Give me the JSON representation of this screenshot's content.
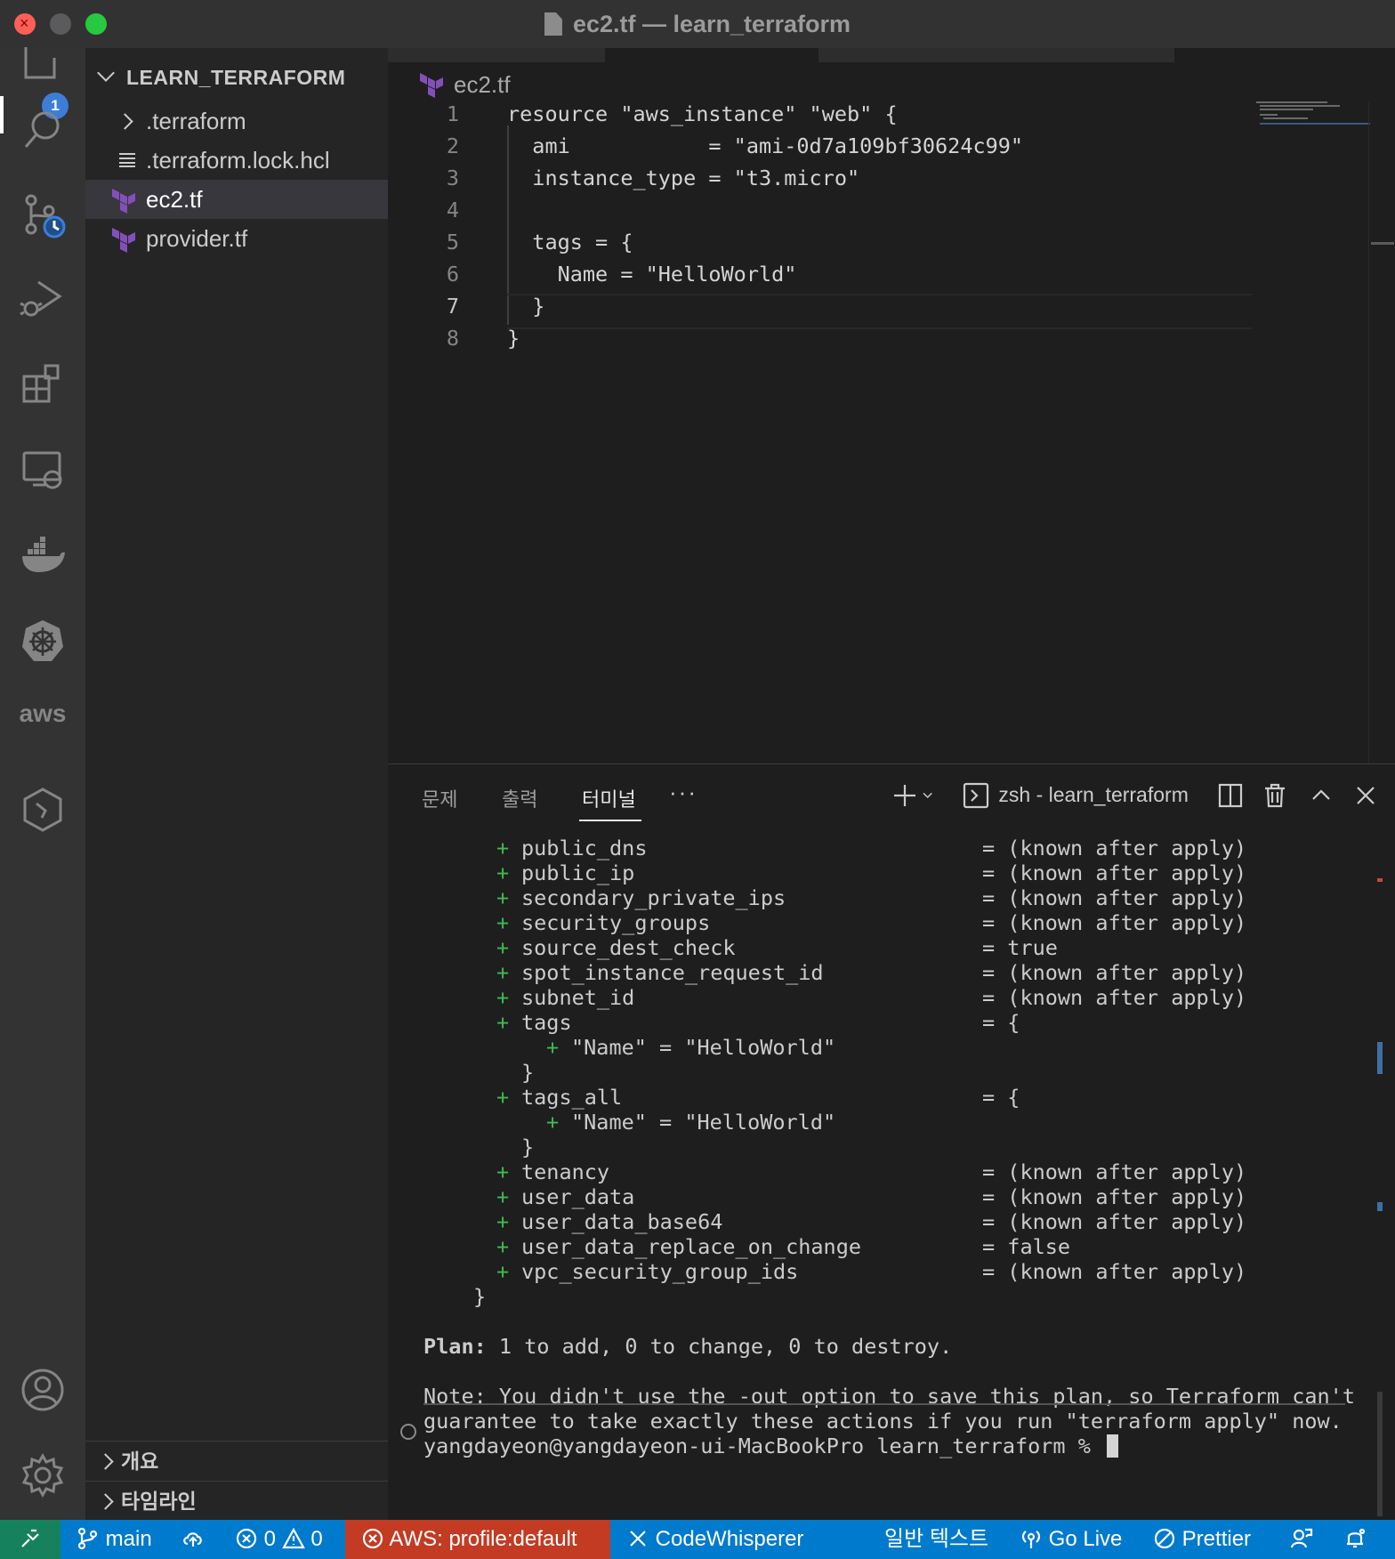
{
  "window": {
    "title": "ec2.tf — learn_terraform"
  },
  "activity_bar": {
    "source_control_badge": "1",
    "aws_label": "aws"
  },
  "explorer": {
    "root": "LEARN_TERRAFORM",
    "items": [
      {
        "label": ".terraform",
        "kind": "folder"
      },
      {
        "label": ".terraform.lock.hcl",
        "kind": "file"
      },
      {
        "label": "ec2.tf",
        "kind": "terraform",
        "active": true
      },
      {
        "label": "provider.tf",
        "kind": "terraform"
      }
    ],
    "outline_label": "개요",
    "timeline_label": "타임라인"
  },
  "editor": {
    "breadcrumb": "ec2.tf",
    "current_line": 7,
    "lines": [
      {
        "num": "1",
        "text": "resource \"aws_instance\" \"web\" {"
      },
      {
        "num": "2",
        "text": "  ami           = \"ami-0d7a109bf30624c99\""
      },
      {
        "num": "3",
        "text": "  instance_type = \"t3.micro\""
      },
      {
        "num": "4",
        "text": ""
      },
      {
        "num": "5",
        "text": "  tags = {"
      },
      {
        "num": "6",
        "text": "    Name = \"HelloWorld\""
      },
      {
        "num": "7",
        "text": "  }"
      },
      {
        "num": "8",
        "text": "}"
      }
    ]
  },
  "panel": {
    "tabs": [
      "문제",
      "출력",
      "터미널"
    ],
    "active_tab": "터미널",
    "more": "···",
    "terminal_name": "zsh - learn_terraform"
  },
  "terminal": {
    "attributes": [
      {
        "plus": "+",
        "name": "public_dns",
        "value": "= (known after apply)"
      },
      {
        "plus": "+",
        "name": "public_ip",
        "value": "= (known after apply)"
      },
      {
        "plus": "+",
        "name": "secondary_private_ips",
        "value": "= (known after apply)"
      },
      {
        "plus": "+",
        "name": "security_groups",
        "value": "= (known after apply)"
      },
      {
        "plus": "+",
        "name": "source_dest_check",
        "value": "= true"
      },
      {
        "plus": "+",
        "name": "spot_instance_request_id",
        "value": "= (known after apply)"
      },
      {
        "plus": "+",
        "name": "subnet_id",
        "value": "= (known after apply)"
      },
      {
        "plus": "+",
        "name": "tags",
        "value": "= {"
      },
      {
        "plus": "+",
        "name": "\"Name\" = \"HelloWorld\"",
        "value": "",
        "nested": true
      },
      {
        "plus": "",
        "name": "}",
        "value": "",
        "closing": true
      },
      {
        "plus": "+",
        "name": "tags_all",
        "value": "= {"
      },
      {
        "plus": "+",
        "name": "\"Name\" = \"HelloWorld\"",
        "value": "",
        "nested": true
      },
      {
        "plus": "",
        "name": "}",
        "value": "",
        "closing": true
      },
      {
        "plus": "+",
        "name": "tenancy",
        "value": "= (known after apply)"
      },
      {
        "plus": "+",
        "name": "user_data",
        "value": "= (known after apply)"
      },
      {
        "plus": "+",
        "name": "user_data_base64",
        "value": "= (known after apply)"
      },
      {
        "plus": "+",
        "name": "user_data_replace_on_change",
        "value": "= false"
      },
      {
        "plus": "+",
        "name": "vpc_security_group_ids",
        "value": "= (known after apply)"
      }
    ],
    "block_close": "}",
    "plan_label": "Plan:",
    "plan_text": " 1 to add, 0 to change, 0 to destroy.",
    "note_line1": "Note: You didn't use the -out option to save this plan, so Terraform can't",
    "note_line2": "guarantee to take exactly these actions if you run \"terraform apply\" now.",
    "prompt": "yangdayeon@yangdayeon-ui-MacBookPro learn_terraform % "
  },
  "status_bar": {
    "branch": "main",
    "errors": "0",
    "warnings": "0",
    "aws_profile": "AWS: profile:default",
    "codewhisperer": "CodeWhisperer",
    "language": "일반 텍스트",
    "go_live": "Go Live",
    "prettier": "Prettier"
  },
  "colors": {
    "accent_statusbar": "#007acc",
    "aws_status": "#c23b22",
    "remote": "#16825d",
    "terraform_purple": "#844fba",
    "plus_green": "#3fb950"
  }
}
